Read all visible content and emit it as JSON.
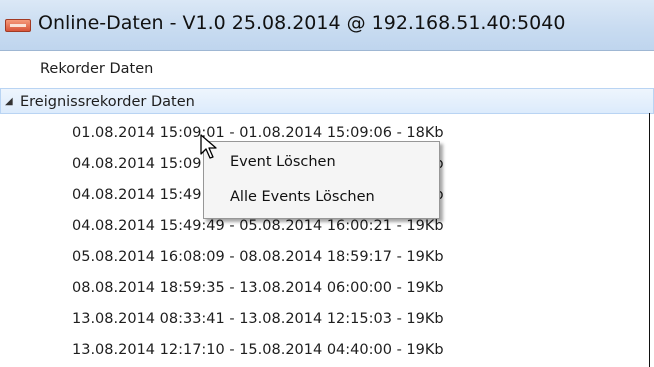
{
  "window": {
    "title": "Online-Daten - V1.0 25.08.2014 @ 192.168.51.40:5040"
  },
  "tree": {
    "top_item": "Rekorder Daten",
    "group": {
      "expander": "◢",
      "label": "Ereignissrekorder Daten",
      "events": [
        "01.08.2014 15:09:01 - 01.08.2014 15:09:06 - 18Kb",
        "04.08.2014 15:09:08 - 04.08.2014 15:49:31 - 19Kb",
        "04.08.2014 15:49:33 - 04.08.2014 15:49:47 - 19Kb",
        "04.08.2014 15:49:49 - 05.08.2014 16:00:21 - 19Kb",
        "05.08.2014 16:08:09 - 08.08.2014 18:59:17 - 19Kb",
        "08.08.2014 18:59:35 - 13.08.2014 06:00:00 - 19Kb",
        "13.08.2014 08:33:41 - 13.08.2014 12:15:03 - 19Kb",
        "13.08.2014 12:17:10 - 15.08.2014 04:40:00 - 19Kb"
      ]
    }
  },
  "context_menu": {
    "items": [
      "Event Löschen",
      "Alle Events Löschen"
    ]
  },
  "icons": {
    "app": "recorder-app-icon",
    "cursor": "mouse-pointer-icon"
  }
}
